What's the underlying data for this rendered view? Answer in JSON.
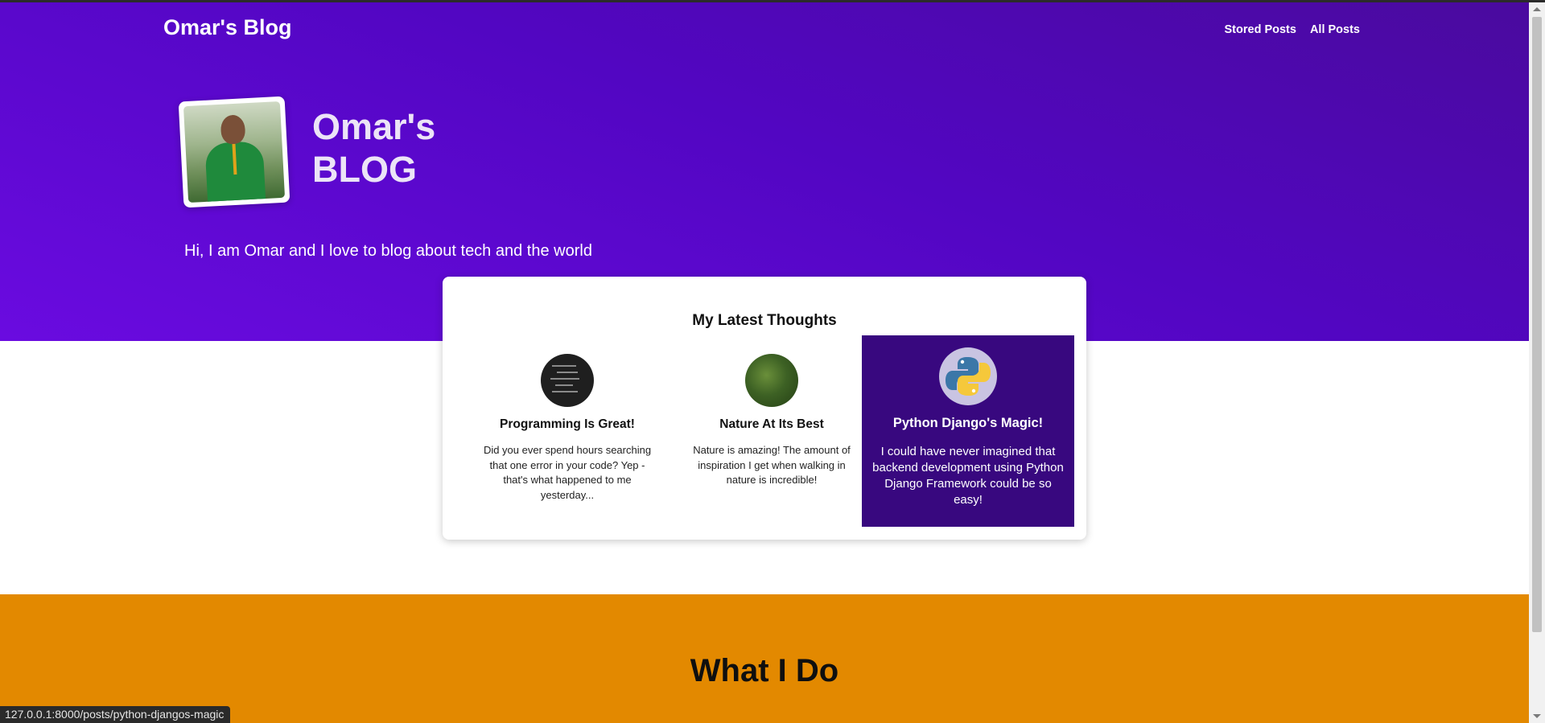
{
  "header": {
    "brand": "Omar's Blog",
    "nav": [
      {
        "label": "Stored Posts"
      },
      {
        "label": "All Posts"
      }
    ]
  },
  "hero": {
    "title_line1": "Omar's",
    "title_line2": "BLOG",
    "tagline": "Hi, I am Omar and I love to blog about tech and the world"
  },
  "latest": {
    "heading": "My Latest Thoughts",
    "posts": [
      {
        "title": "Programming Is Great!",
        "excerpt": "Did you ever spend hours searching that one error in your code? Yep - that's what happened to me yesterday...",
        "image": "code-image"
      },
      {
        "title": "Nature At Its Best",
        "excerpt": "Nature is amazing! The amount of inspiration I get when walking in nature is incredible!",
        "image": "nature-image"
      },
      {
        "title": "Python Django's Magic!",
        "excerpt": "I could have never imagined that backend development using Python Django Framework could be so easy!",
        "image": "python-logo-icon",
        "highlighted": true
      }
    ]
  },
  "section": {
    "title": "What I Do"
  },
  "status": {
    "url": "127.0.0.1:8000/posts/python-djangos-magic"
  },
  "colors": {
    "hero_gradient": [
      "#4a0a9e",
      "#6a0be0"
    ],
    "highlight_card": "#38087f",
    "section_orange": "#e38900"
  }
}
